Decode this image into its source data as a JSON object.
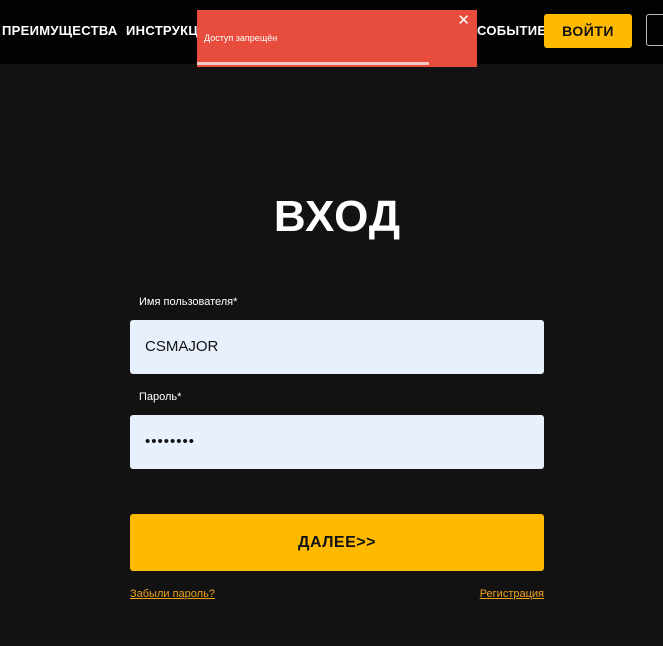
{
  "header": {
    "nav": {
      "advantages": "ПРЕИМУЩЕСТВА",
      "instructions": "ИНСТРУКЦИЯ",
      "event": "СОБЫТИЕ"
    },
    "login_label": "ВОЙТИ"
  },
  "toast": {
    "message": "Доступ запрещён",
    "close_glyph": "✕",
    "progress": 0.83,
    "color": "#e74c3c"
  },
  "form": {
    "title": "ВХОД",
    "username": {
      "label": "Имя пользователя*",
      "value": "CSMAJOR"
    },
    "password": {
      "label": "Пароль*",
      "value": "••••••••"
    },
    "submit_label": "ДАЛЕЕ>>",
    "forgot_link": "Забыли пароль?",
    "register_link": "Регистрация"
  },
  "colors": {
    "background": "#121212",
    "topbar": "#020202",
    "accent": "#ffba00",
    "field": "#e8f0fe",
    "link": "#f0a31a"
  }
}
